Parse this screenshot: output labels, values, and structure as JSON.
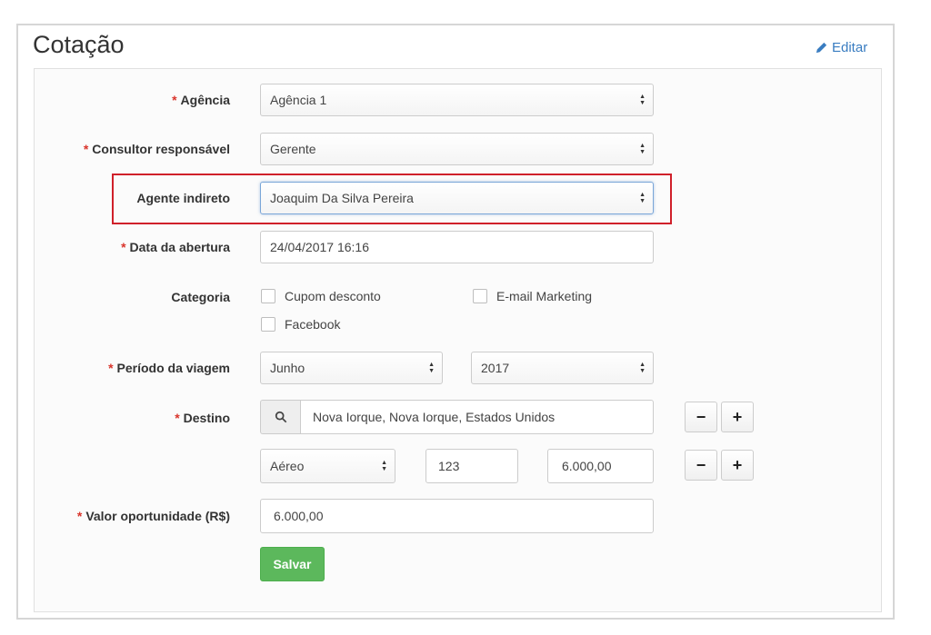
{
  "header": {
    "title": "Cotação",
    "edit_label": "Editar"
  },
  "required_mark": "*",
  "form": {
    "agencia": {
      "label": "Agência",
      "value": "Agência 1"
    },
    "consultor": {
      "label": "Consultor responsável",
      "value": "Gerente"
    },
    "agente": {
      "label": "Agente indireto",
      "value": "Joaquim Da Silva Pereira"
    },
    "data_abertura": {
      "label": "Data da abertura",
      "value": "24/04/2017 16:16"
    },
    "categoria": {
      "label": "Categoria",
      "options": [
        {
          "label": "Cupom desconto",
          "checked": false
        },
        {
          "label": "E-mail Marketing",
          "checked": false
        },
        {
          "label": "Facebook",
          "checked": false
        }
      ]
    },
    "periodo": {
      "label": "Período da viagem",
      "month": "Junho",
      "year": "2017"
    },
    "destino": {
      "label": "Destino",
      "value": "Nova Iorque, Nova Iorque, Estados Unidos",
      "transport": "Aéreo",
      "quantity": "123",
      "amount": "6.000,00",
      "minus_label": "−",
      "plus_label": "+"
    },
    "valor": {
      "label": "Valor oportunidade (R$)",
      "value": "6.000,00"
    },
    "save_label": "Salvar"
  },
  "colors": {
    "required": "#d9342b",
    "link": "#3a7dc1",
    "save": "#5cb85c",
    "highlight": "#d0202a"
  }
}
